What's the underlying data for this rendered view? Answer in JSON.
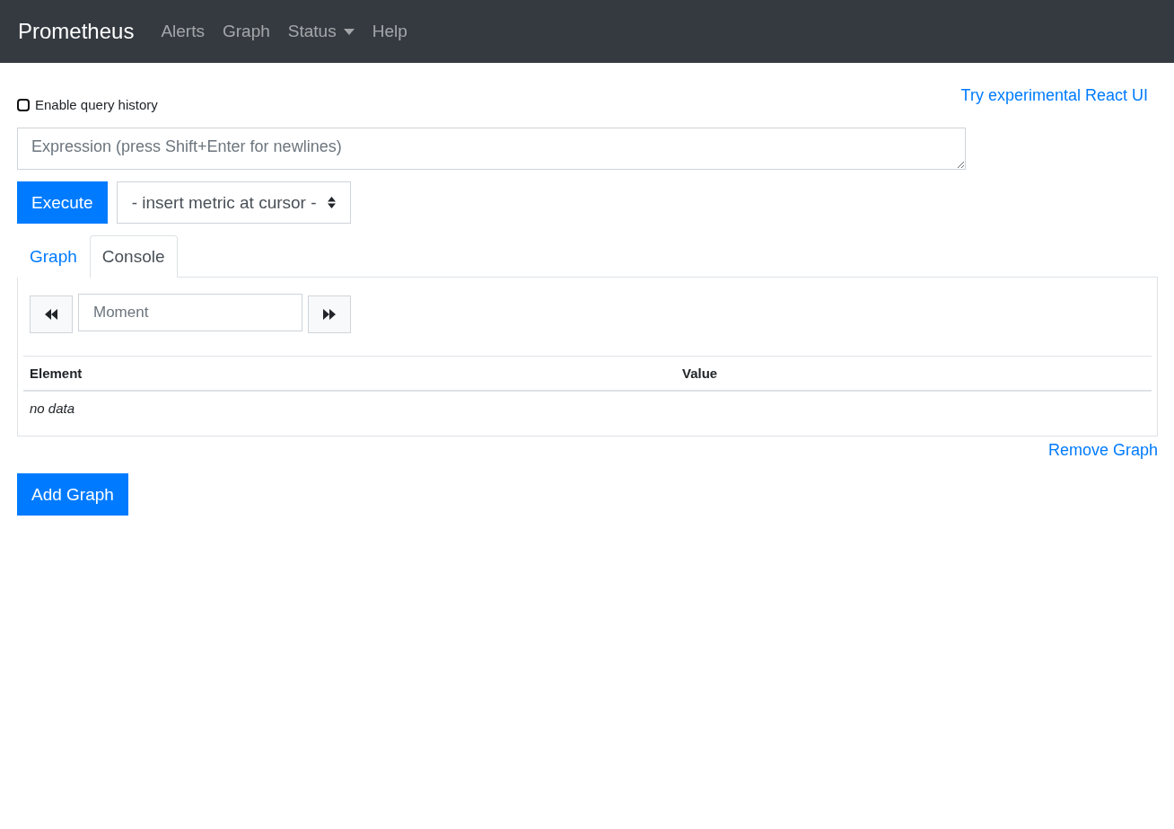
{
  "navbar": {
    "brand": "Prometheus",
    "items": [
      {
        "label": "Alerts",
        "dropdown": false
      },
      {
        "label": "Graph",
        "dropdown": false
      },
      {
        "label": "Status",
        "dropdown": true
      },
      {
        "label": "Help",
        "dropdown": false
      }
    ]
  },
  "history": {
    "label": "Enable query history",
    "checked": false
  },
  "react_link": "Try experimental React UI",
  "expression": {
    "placeholder": "Expression (press Shift+Enter for newlines)"
  },
  "execute_button": "Execute",
  "metric_select": "- insert metric at cursor -",
  "tabs": [
    {
      "label": "Graph",
      "selected": false
    },
    {
      "label": "Console",
      "selected": true
    }
  ],
  "moment": {
    "placeholder": "Moment"
  },
  "table": {
    "columns": [
      "Element",
      "Value"
    ],
    "empty": "no data"
  },
  "remove_link": "Remove Graph",
  "add_button": "Add Graph"
}
